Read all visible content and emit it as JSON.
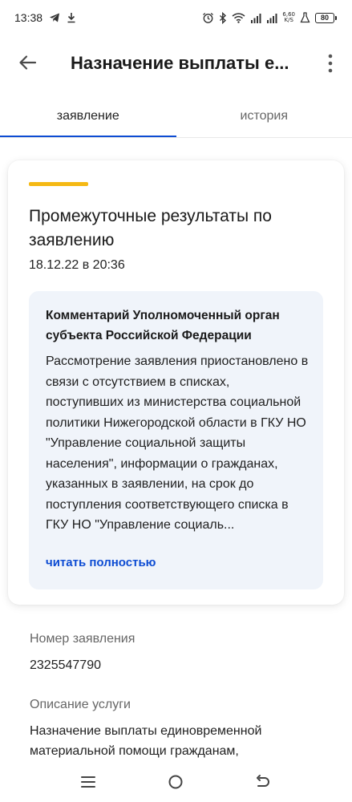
{
  "status_bar": {
    "time": "13:38",
    "network_speed_value": "6,60",
    "network_speed_unit": "K/S",
    "battery": "80",
    "icons": [
      "telegram-icon",
      "download-icon",
      "alarm-icon",
      "bluetooth-icon",
      "wifi-icon",
      "signal-icon",
      "signal-icon",
      "flask-icon"
    ]
  },
  "header": {
    "title": "Назначение выплаты е..."
  },
  "tabs": [
    {
      "label": "заявление",
      "active": true
    },
    {
      "label": "история",
      "active": false
    }
  ],
  "card": {
    "accent_color": "#f5b914",
    "title": "Промежуточные результаты по заявлению",
    "date": "18.12.22 в 20:36",
    "comment": {
      "title": "Комментарий Уполномоченный орган субъекта Российской Федерации",
      "body": "Рассмотрение заявления приостановлено в связи с отсутствием в списках, поступивших из министерства социальной политики Нижегородской области в ГКУ НО \"Управление социальной защиты населения\", информации о гражданах, указанных в заявлении, на срок до поступления соответствующего списка в ГКУ НО \"Управление социаль...",
      "read_more": "читать полностью"
    }
  },
  "details": {
    "number_label": "Номер заявления",
    "number_value": "2325547790",
    "description_label": "Описание услуги",
    "description_value": "Назначение выплаты единовременной материальной помощи гражданам,"
  },
  "colors": {
    "accent_blue": "#0d4cd3",
    "comment_bg": "#f0f4fa"
  }
}
